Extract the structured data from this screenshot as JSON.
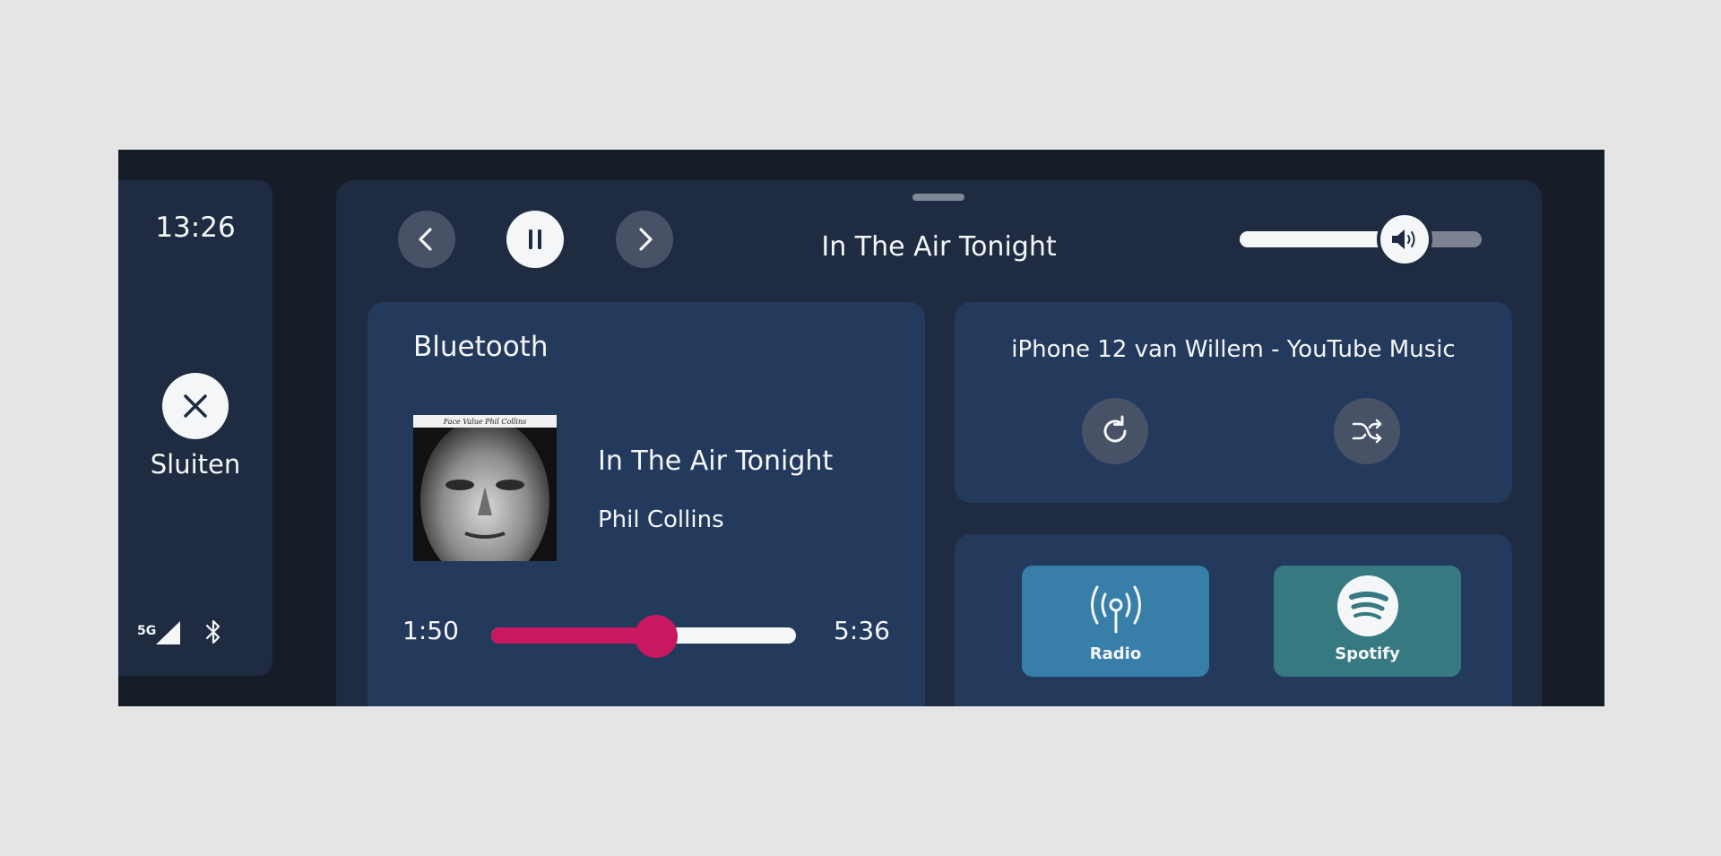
{
  "status": {
    "time": "13:26",
    "close_label": "Sluiten",
    "network": "5G",
    "icons": [
      "close-icon",
      "signal-icon",
      "bluetooth-icon"
    ]
  },
  "player": {
    "now_playing_title": "In The Air Tonight",
    "volume_fraction": 0.68,
    "icons": [
      "previous-icon",
      "pause-icon",
      "next-icon",
      "speaker-icon"
    ]
  },
  "bluetooth_card": {
    "title": "Bluetooth",
    "track_title": "In The Air Tonight",
    "artist": "Phil Collins",
    "album_cover_text": "Face Value  Phil Collins",
    "elapsed": "1:50",
    "duration": "5:36",
    "progress_fraction": 0.54
  },
  "device_card": {
    "title": "iPhone 12 van Willem - YouTube Music",
    "icons": [
      "repeat-icon",
      "shuffle-icon"
    ]
  },
  "sources": [
    {
      "label": "Radio",
      "icon": "radio-antenna-icon",
      "color": "#377ea9"
    },
    {
      "label": "Spotify",
      "icon": "spotify-icon",
      "color": "#377981"
    }
  ],
  "colors": {
    "background": "#171d27",
    "panel": "#1e2b41",
    "card": "#233a5d",
    "accent": "#c8185f"
  }
}
